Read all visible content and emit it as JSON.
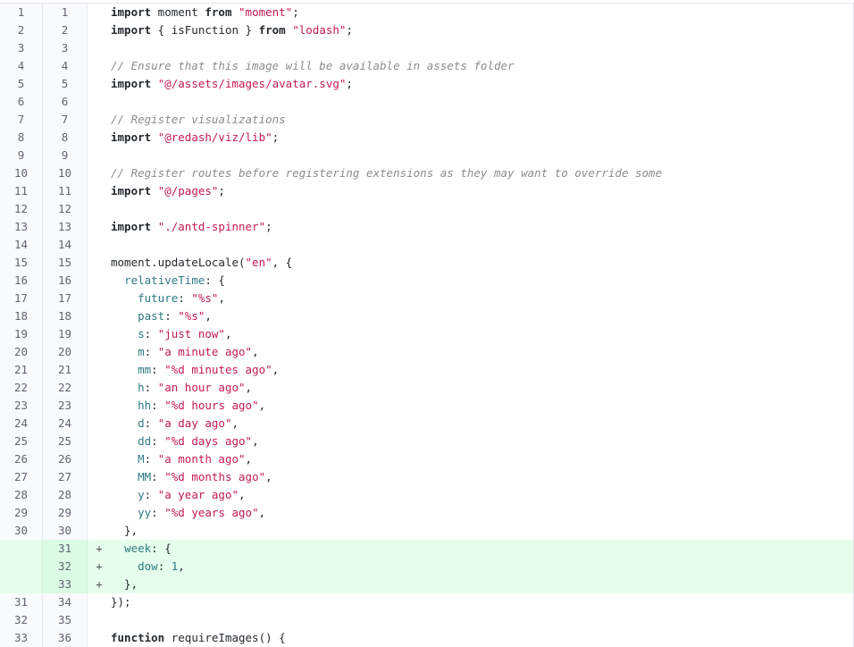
{
  "rows": [
    {
      "old": "1",
      "new": "1",
      "type": "ctx",
      "tokens": [
        [
          "kw",
          "import"
        ],
        [
          "p",
          " moment "
        ],
        [
          "kw",
          "from"
        ],
        [
          "p",
          " "
        ],
        [
          "str",
          "\"moment\""
        ],
        [
          "p",
          ";"
        ]
      ]
    },
    {
      "old": "2",
      "new": "2",
      "type": "ctx",
      "tokens": [
        [
          "kw",
          "import"
        ],
        [
          "p",
          " { isFunction } "
        ],
        [
          "kw",
          "from"
        ],
        [
          "p",
          " "
        ],
        [
          "str",
          "\"lodash\""
        ],
        [
          "p",
          ";"
        ]
      ]
    },
    {
      "old": "3",
      "new": "3",
      "type": "ctx",
      "tokens": []
    },
    {
      "old": "4",
      "new": "4",
      "type": "ctx",
      "tokens": [
        [
          "cm",
          "// Ensure that this image will be available in assets folder"
        ]
      ]
    },
    {
      "old": "5",
      "new": "5",
      "type": "ctx",
      "tokens": [
        [
          "kw",
          "import"
        ],
        [
          "p",
          " "
        ],
        [
          "str",
          "\"@/assets/images/avatar.svg\""
        ],
        [
          "p",
          ";"
        ]
      ]
    },
    {
      "old": "6",
      "new": "6",
      "type": "ctx",
      "tokens": []
    },
    {
      "old": "7",
      "new": "7",
      "type": "ctx",
      "tokens": [
        [
          "cm",
          "// Register visualizations"
        ]
      ]
    },
    {
      "old": "8",
      "new": "8",
      "type": "ctx",
      "tokens": [
        [
          "kw",
          "import"
        ],
        [
          "p",
          " "
        ],
        [
          "str",
          "\"@redash/viz/lib\""
        ],
        [
          "p",
          ";"
        ]
      ]
    },
    {
      "old": "9",
      "new": "9",
      "type": "ctx",
      "tokens": []
    },
    {
      "old": "10",
      "new": "10",
      "type": "ctx",
      "tokens": [
        [
          "cm",
          "// Register routes before registering extensions as they may want to override some"
        ]
      ]
    },
    {
      "old": "11",
      "new": "11",
      "type": "ctx",
      "tokens": [
        [
          "kw",
          "import"
        ],
        [
          "p",
          " "
        ],
        [
          "str",
          "\"@/pages\""
        ],
        [
          "p",
          ";"
        ]
      ]
    },
    {
      "old": "12",
      "new": "12",
      "type": "ctx",
      "tokens": []
    },
    {
      "old": "13",
      "new": "13",
      "type": "ctx",
      "tokens": [
        [
          "kw",
          "import"
        ],
        [
          "p",
          " "
        ],
        [
          "str",
          "\"./antd-spinner\""
        ],
        [
          "p",
          ";"
        ]
      ]
    },
    {
      "old": "14",
      "new": "14",
      "type": "ctx",
      "tokens": []
    },
    {
      "old": "15",
      "new": "15",
      "type": "ctx",
      "tokens": [
        [
          "p",
          "moment.updateLocale("
        ],
        [
          "str",
          "\"en\""
        ],
        [
          "p",
          ", {"
        ]
      ]
    },
    {
      "old": "16",
      "new": "16",
      "type": "ctx",
      "tokens": [
        [
          "p",
          "  "
        ],
        [
          "prop",
          "relativeTime"
        ],
        [
          "p",
          ": {"
        ]
      ]
    },
    {
      "old": "17",
      "new": "17",
      "type": "ctx",
      "tokens": [
        [
          "p",
          "    "
        ],
        [
          "prop",
          "future"
        ],
        [
          "p",
          ": "
        ],
        [
          "str",
          "\"%s\""
        ],
        [
          "p",
          ","
        ]
      ]
    },
    {
      "old": "18",
      "new": "18",
      "type": "ctx",
      "tokens": [
        [
          "p",
          "    "
        ],
        [
          "prop",
          "past"
        ],
        [
          "p",
          ": "
        ],
        [
          "str",
          "\"%s\""
        ],
        [
          "p",
          ","
        ]
      ]
    },
    {
      "old": "19",
      "new": "19",
      "type": "ctx",
      "tokens": [
        [
          "p",
          "    "
        ],
        [
          "prop",
          "s"
        ],
        [
          "p",
          ": "
        ],
        [
          "str",
          "\"just now\""
        ],
        [
          "p",
          ","
        ]
      ]
    },
    {
      "old": "20",
      "new": "20",
      "type": "ctx",
      "tokens": [
        [
          "p",
          "    "
        ],
        [
          "prop",
          "m"
        ],
        [
          "p",
          ": "
        ],
        [
          "str",
          "\"a minute ago\""
        ],
        [
          "p",
          ","
        ]
      ]
    },
    {
      "old": "21",
      "new": "21",
      "type": "ctx",
      "tokens": [
        [
          "p",
          "    "
        ],
        [
          "prop",
          "mm"
        ],
        [
          "p",
          ": "
        ],
        [
          "str",
          "\"%d minutes ago\""
        ],
        [
          "p",
          ","
        ]
      ]
    },
    {
      "old": "22",
      "new": "22",
      "type": "ctx",
      "tokens": [
        [
          "p",
          "    "
        ],
        [
          "prop",
          "h"
        ],
        [
          "p",
          ": "
        ],
        [
          "str",
          "\"an hour ago\""
        ],
        [
          "p",
          ","
        ]
      ]
    },
    {
      "old": "23",
      "new": "23",
      "type": "ctx",
      "tokens": [
        [
          "p",
          "    "
        ],
        [
          "prop",
          "hh"
        ],
        [
          "p",
          ": "
        ],
        [
          "str",
          "\"%d hours ago\""
        ],
        [
          "p",
          ","
        ]
      ]
    },
    {
      "old": "24",
      "new": "24",
      "type": "ctx",
      "tokens": [
        [
          "p",
          "    "
        ],
        [
          "prop",
          "d"
        ],
        [
          "p",
          ": "
        ],
        [
          "str",
          "\"a day ago\""
        ],
        [
          "p",
          ","
        ]
      ]
    },
    {
      "old": "25",
      "new": "25",
      "type": "ctx",
      "tokens": [
        [
          "p",
          "    "
        ],
        [
          "prop",
          "dd"
        ],
        [
          "p",
          ": "
        ],
        [
          "str",
          "\"%d days ago\""
        ],
        [
          "p",
          ","
        ]
      ]
    },
    {
      "old": "26",
      "new": "26",
      "type": "ctx",
      "tokens": [
        [
          "p",
          "    "
        ],
        [
          "prop",
          "M"
        ],
        [
          "p",
          ": "
        ],
        [
          "str",
          "\"a month ago\""
        ],
        [
          "p",
          ","
        ]
      ]
    },
    {
      "old": "27",
      "new": "27",
      "type": "ctx",
      "tokens": [
        [
          "p",
          "    "
        ],
        [
          "prop",
          "MM"
        ],
        [
          "p",
          ": "
        ],
        [
          "str",
          "\"%d months ago\""
        ],
        [
          "p",
          ","
        ]
      ]
    },
    {
      "old": "28",
      "new": "28",
      "type": "ctx",
      "tokens": [
        [
          "p",
          "    "
        ],
        [
          "prop",
          "y"
        ],
        [
          "p",
          ": "
        ],
        [
          "str",
          "\"a year ago\""
        ],
        [
          "p",
          ","
        ]
      ]
    },
    {
      "old": "29",
      "new": "29",
      "type": "ctx",
      "tokens": [
        [
          "p",
          "    "
        ],
        [
          "prop",
          "yy"
        ],
        [
          "p",
          ": "
        ],
        [
          "str",
          "\"%d years ago\""
        ],
        [
          "p",
          ","
        ]
      ]
    },
    {
      "old": "30",
      "new": "30",
      "type": "ctx",
      "tokens": [
        [
          "p",
          "  },"
        ]
      ]
    },
    {
      "old": "",
      "new": "31",
      "type": "add",
      "sign": "+",
      "tokens": [
        [
          "p",
          "  "
        ],
        [
          "prop",
          "week"
        ],
        [
          "p",
          ": {"
        ]
      ]
    },
    {
      "old": "",
      "new": "32",
      "type": "add",
      "sign": "+",
      "tokens": [
        [
          "p",
          "    "
        ],
        [
          "prop",
          "dow"
        ],
        [
          "p",
          ": "
        ],
        [
          "num",
          "1"
        ],
        [
          "p",
          ","
        ]
      ]
    },
    {
      "old": "",
      "new": "33",
      "type": "add",
      "sign": "+",
      "tokens": [
        [
          "p",
          "  },"
        ]
      ]
    },
    {
      "old": "31",
      "new": "34",
      "type": "ctx",
      "tokens": [
        [
          "p",
          "});"
        ]
      ]
    },
    {
      "old": "32",
      "new": "35",
      "type": "ctx",
      "tokens": []
    },
    {
      "old": "33",
      "new": "36",
      "type": "ctx",
      "tokens": [
        [
          "kw",
          "function"
        ],
        [
          "p",
          " requireImages() {"
        ]
      ]
    }
  ]
}
